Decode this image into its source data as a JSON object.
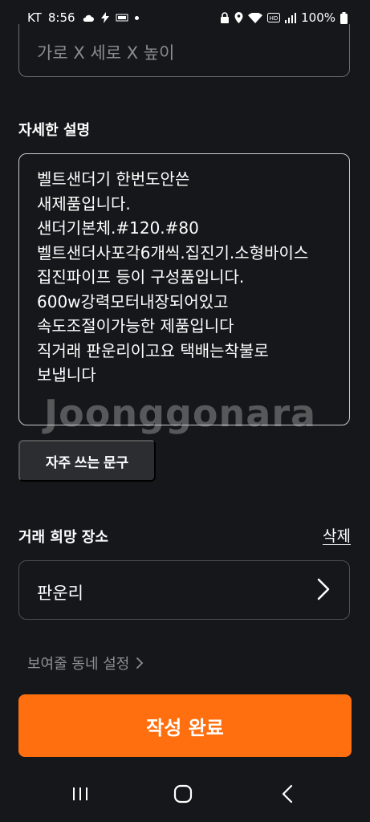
{
  "status_bar": {
    "carrier": "KT",
    "time": "8:56",
    "battery": "100%",
    "icons_left": [
      "cloud-icon",
      "bolt-icon",
      "app-badge-icon",
      "dot-icon"
    ],
    "icons_right": [
      "lock-icon",
      "location-icon",
      "wifi-icon",
      "hd-icon",
      "signal-icon",
      "battery-icon"
    ]
  },
  "size_field": {
    "placeholder": "가로 X 세로 X 높이"
  },
  "description": {
    "label": "자세한 설명",
    "value": "벨트샌더기 한번도안쓴\n새제품입니다.\n샌더기본체.#120.#80\n벨트샌더사포각6개씩.집진기.소형바이스\n집진파이프 등이 구성품입니다.\n600w강력모터내장되어있고\n속도조절이가능한 제품입니다\n직거래 판운리이고요 택배는착불로\n보냅니다",
    "watermark": "Joonggonara"
  },
  "frequent_phrases_button": "자주 쓰는 문구",
  "location": {
    "label": "거래 희망 장소",
    "delete_label": "삭제",
    "value": "판운리"
  },
  "neighborhood_setting": "보여줄 동네 설정",
  "submit_button": "작성 완료",
  "colors": {
    "accent": "#ff6f0f",
    "background": "#16171a"
  }
}
